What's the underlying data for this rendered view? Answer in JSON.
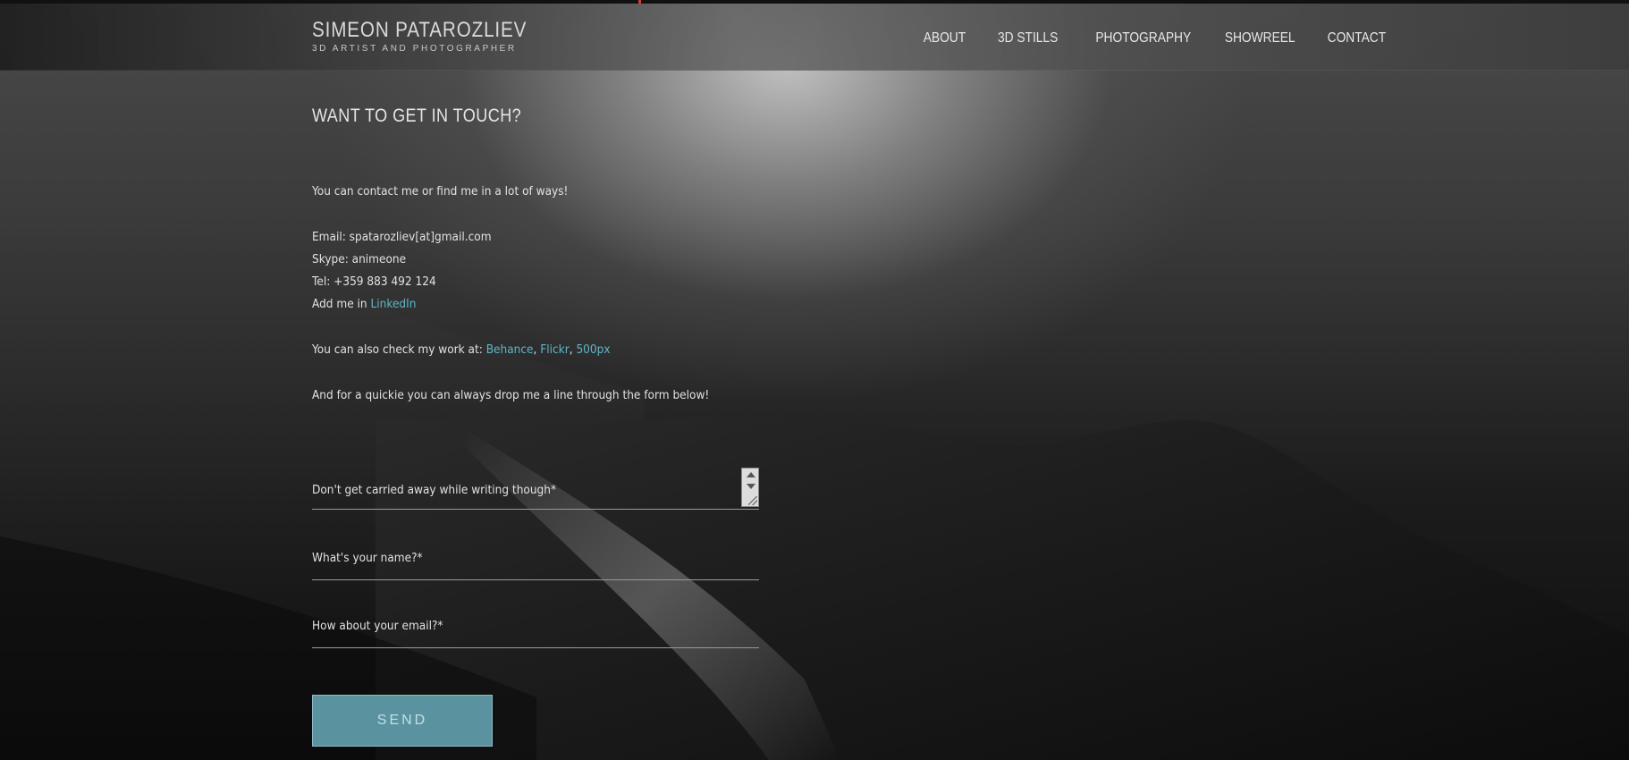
{
  "brand": {
    "name": "SIMEON PATAROZLIEV",
    "tagline": "3D ARTIST AND PHOTOGRAPHER"
  },
  "nav": {
    "items": [
      {
        "label": "ABOUT"
      },
      {
        "label": "3D STILLS"
      },
      {
        "label": "PHOTOGRAPHY"
      },
      {
        "label": "SHOWREEL"
      },
      {
        "label": "CONTACT"
      }
    ]
  },
  "main": {
    "title": "WANT TO GET IN TOUCH?",
    "intro": "You can contact me or find me in a lot of ways!",
    "email_line": "Email: spatarozliev[at]gmail.com",
    "skype_line": "Skype: animeone",
    "tel_line": "Tel: +359 883 492 124",
    "add_prefix": "Add me in ",
    "linkedin_label": "LinkedIn",
    "check_prefix": "You can also check my work at: ",
    "behance_label": "Behance",
    "flickr_label": "Flickr",
    "px500_label": "500px",
    "separator": ", ",
    "quickie": "And for a quickie you can always drop me a line through the form below!"
  },
  "form": {
    "message_label": "Don't get carried away while writing though*",
    "name_label": "What's your name?*",
    "email_label": "How about your email?*",
    "send_label": "SEND"
  },
  "colors": {
    "link": "#5fb6c8",
    "button": "#5a939f",
    "accent_tick": "#d23a3a"
  }
}
